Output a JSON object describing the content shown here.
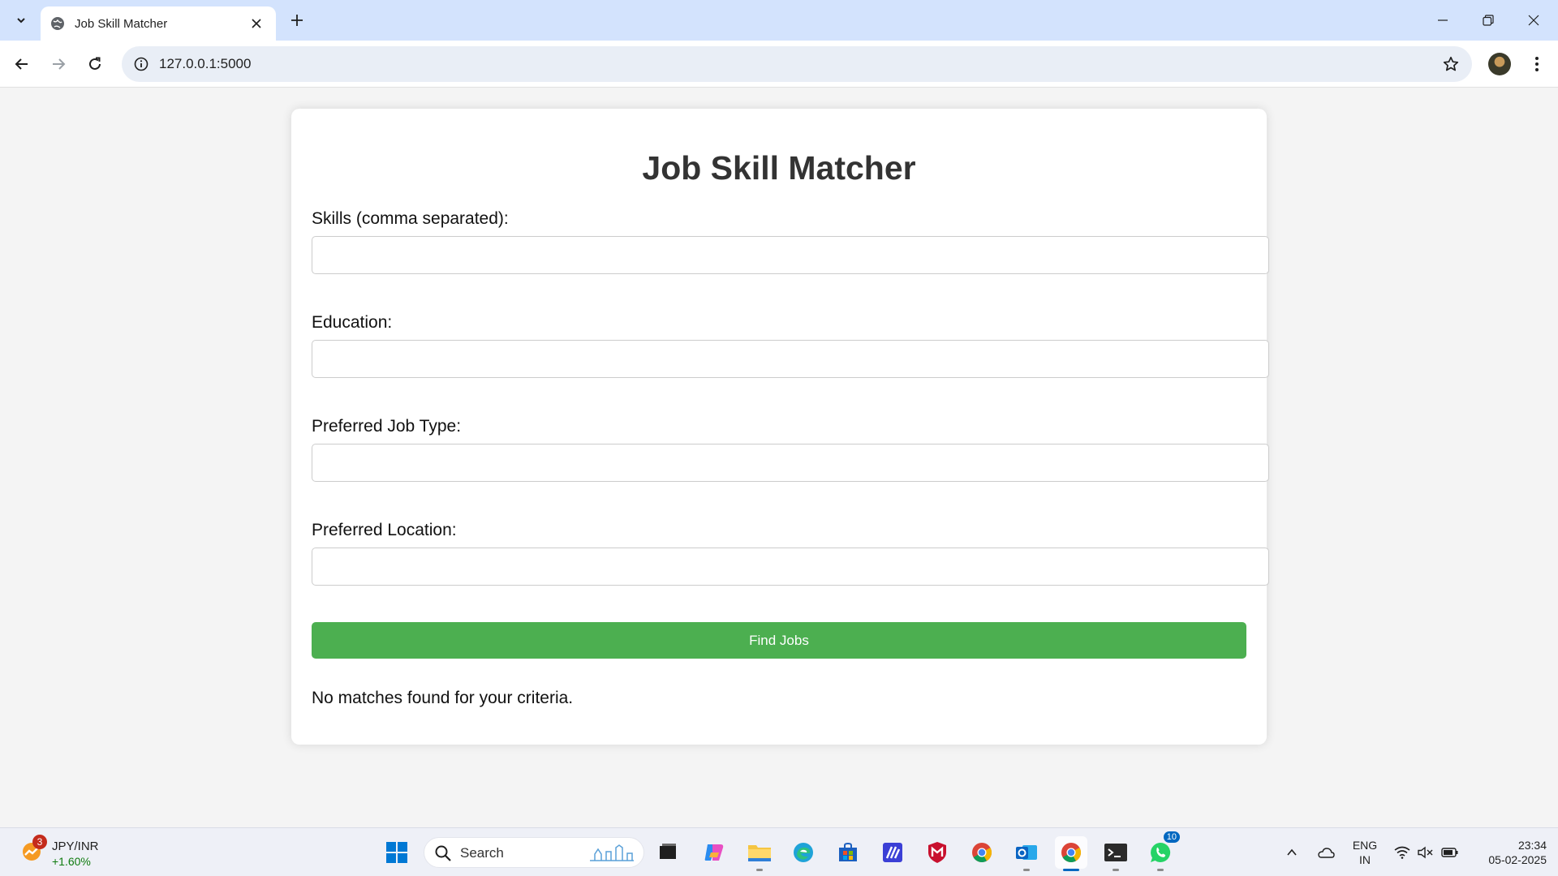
{
  "browser": {
    "tab_title": "Job Skill Matcher",
    "url": "127.0.0.1:5000"
  },
  "page": {
    "heading": "Job Skill Matcher",
    "fields": [
      {
        "label": "Skills (comma separated):",
        "value": ""
      },
      {
        "label": "Education:",
        "value": ""
      },
      {
        "label": "Preferred Job Type:",
        "value": ""
      },
      {
        "label": "Preferred Location:",
        "value": ""
      }
    ],
    "submit_label": "Find Jobs",
    "result_message": "No matches found for your criteria."
  },
  "taskbar": {
    "widget": {
      "badge": "3",
      "title": "JPY/INR",
      "change": "+1.60%"
    },
    "search_label": "Search",
    "whatsapp_badge": "10",
    "language": {
      "line1": "ENG",
      "line2": "IN"
    },
    "clock": {
      "time": "23:34",
      "date": "05-02-2025"
    }
  },
  "colors": {
    "accent_button": "#4caf50",
    "tabstrip": "#d3e3fd",
    "page_background": "#f4f4f4"
  }
}
